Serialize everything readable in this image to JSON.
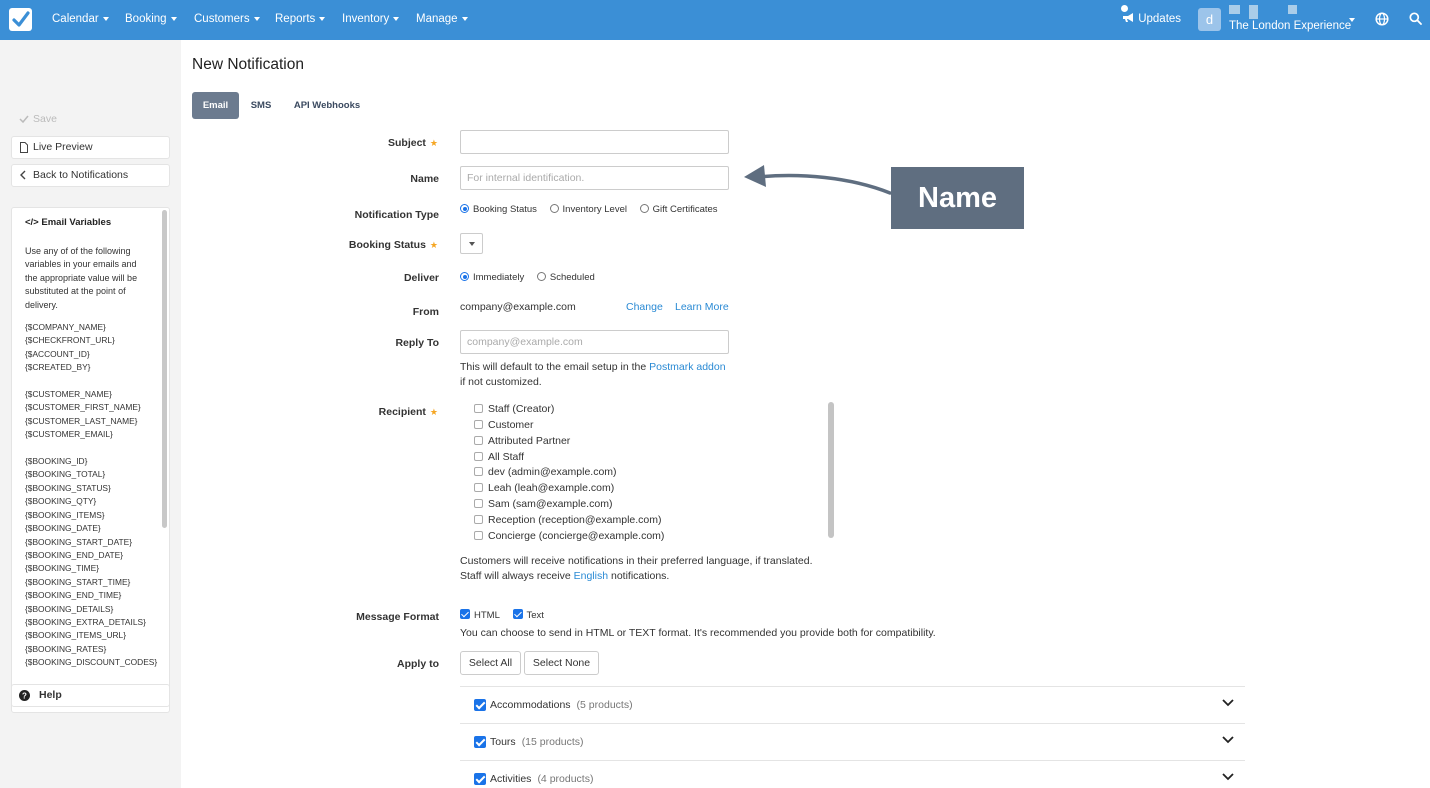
{
  "nav": {
    "items": [
      {
        "label": "Calendar"
      },
      {
        "label": "Booking"
      },
      {
        "label": "Customers"
      },
      {
        "label": "Reports"
      },
      {
        "label": "Inventory"
      },
      {
        "label": "Manage"
      }
    ],
    "updates_label": "Updates",
    "avatar_letter": "d",
    "account_name": "The London Experience",
    "brand_color": "#3b8fd6"
  },
  "sidebar": {
    "save_label": "Save",
    "live_preview_label": "Live Preview",
    "back_label": "Back to Notifications",
    "vars_title": "Email Variables",
    "vars_desc": "Use any of of the following variables in your emails and the appropriate value will be substituted at the point of delivery.",
    "vars_group1": [
      "{$COMPANY_NAME}",
      "{$CHECKFRONT_URL}",
      "{$ACCOUNT_ID}",
      "{$CREATED_BY}"
    ],
    "vars_group2": [
      "{$CUSTOMER_NAME}",
      "{$CUSTOMER_FIRST_NAME}",
      "{$CUSTOMER_LAST_NAME}",
      "{$CUSTOMER_EMAIL}"
    ],
    "vars_group3": [
      "{$BOOKING_ID}",
      "{$BOOKING_TOTAL}",
      "{$BOOKING_STATUS}",
      "{$BOOKING_QTY}",
      "{$BOOKING_ITEMS}",
      "{$BOOKING_DATE}",
      "{$BOOKING_START_DATE}",
      "{$BOOKING_END_DATE}",
      "{$BOOKING_TIME}",
      "{$BOOKING_START_TIME}",
      "{$BOOKING_END_TIME}",
      "{$BOOKING_DETAILS}",
      "{$BOOKING_EXTRA_DETAILS}",
      "{$BOOKING_ITEMS_URL}",
      "{$BOOKING_RATES}",
      "{$BOOKING_DISCOUNT_CODES}"
    ],
    "help_label": "Help"
  },
  "page": {
    "title": "New Notification",
    "tabs": [
      {
        "label": "Email"
      },
      {
        "label": "SMS"
      },
      {
        "label": "API Webhooks"
      }
    ]
  },
  "form": {
    "subject_label": "Subject",
    "name_label": "Name",
    "name_placeholder": "For internal identification.",
    "notification_type_label": "Notification Type",
    "notification_type_options": [
      "Booking Status",
      "Inventory Level",
      "Gift Certificates"
    ],
    "booking_status_label": "Booking Status",
    "deliver_label": "Deliver",
    "deliver_options": [
      "Immediately",
      "Scheduled"
    ],
    "from_label": "From",
    "from_value": "company@example.com",
    "change_link": "Change",
    "learn_more_link": "Learn More",
    "reply_to_label": "Reply To",
    "reply_to_placeholder": "company@example.com",
    "reply_help_1": "This will default to the email setup in the ",
    "reply_help_link": "Postmark addon",
    "reply_help_2": "if not customized.",
    "recipient_label": "Recipient",
    "recipients": [
      "Staff (Creator)",
      "Customer",
      "Attributed Partner",
      "All Staff",
      "dev (admin@example.com)",
      "Leah (leah@example.com)",
      "Sam (sam@example.com)",
      "Reception (reception@example.com)",
      "Concierge (concierge@example.com)"
    ],
    "lang_help_1": "Customers will receive notifications in their preferred language, if translated.",
    "lang_help_2a": "Staff will always receive ",
    "lang_help_link": "English",
    "lang_help_2b": " notifications.",
    "message_format_label": "Message Format",
    "format_html": "HTML",
    "format_text": "Text",
    "format_help": "You can choose to send in HTML or TEXT format. It's recommended you provide both for compatibility.",
    "apply_to_label": "Apply to",
    "select_all": "Select All",
    "select_none": "Select None",
    "categories": [
      {
        "name": "Accommodations",
        "count": "(5 products)"
      },
      {
        "name": "Tours",
        "count": "(15 products)"
      },
      {
        "name": "Activities",
        "count": "(4 products)"
      }
    ]
  },
  "callout": {
    "label": "Name",
    "color": "#5f6e80"
  }
}
